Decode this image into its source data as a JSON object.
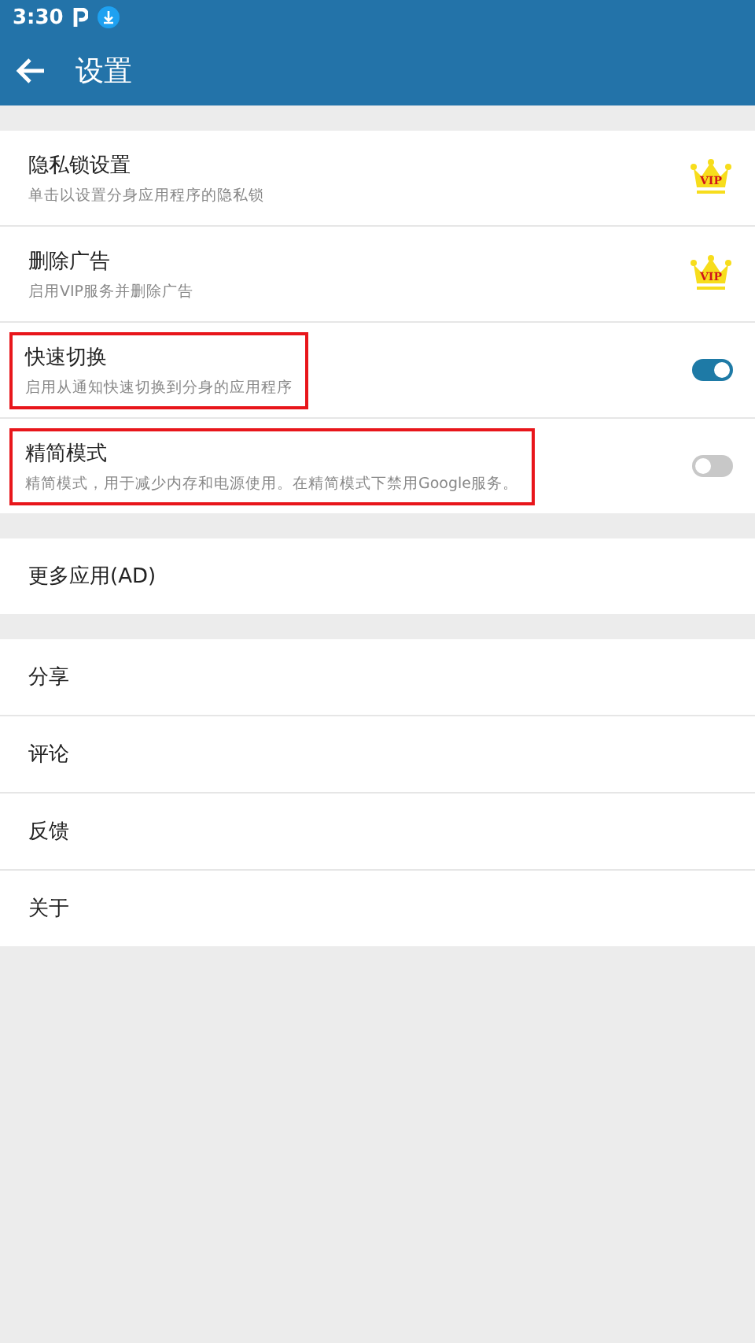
{
  "status_bar": {
    "time": "3:30"
  },
  "toolbar": {
    "title": "设置"
  },
  "groups": [
    {
      "items": [
        {
          "kind": "vip",
          "title": "隐私锁设置",
          "subtitle": "单击以设置分身应用程序的隐私锁",
          "badge": "VIP",
          "highlighted": false
        },
        {
          "kind": "vip",
          "title": "删除广告",
          "subtitle": "启用VIP服务并删除广告",
          "badge": "VIP",
          "highlighted": false
        },
        {
          "kind": "switch",
          "title": "快速切换",
          "subtitle": "启用从通知快速切换到分身的应用程序",
          "on": true,
          "highlighted": true
        },
        {
          "kind": "switch",
          "title": "精简模式",
          "subtitle": "精简模式，用于减少内存和电源使用。在精简模式下禁用Google服务。",
          "on": false,
          "highlighted": true
        }
      ]
    },
    {
      "items": [
        {
          "kind": "plain",
          "title": "更多应用(AD)"
        }
      ]
    },
    {
      "items": [
        {
          "kind": "plain",
          "title": "分享"
        },
        {
          "kind": "plain",
          "title": "评论"
        },
        {
          "kind": "plain",
          "title": "反馈"
        },
        {
          "kind": "plain",
          "title": "关于"
        }
      ]
    }
  ]
}
